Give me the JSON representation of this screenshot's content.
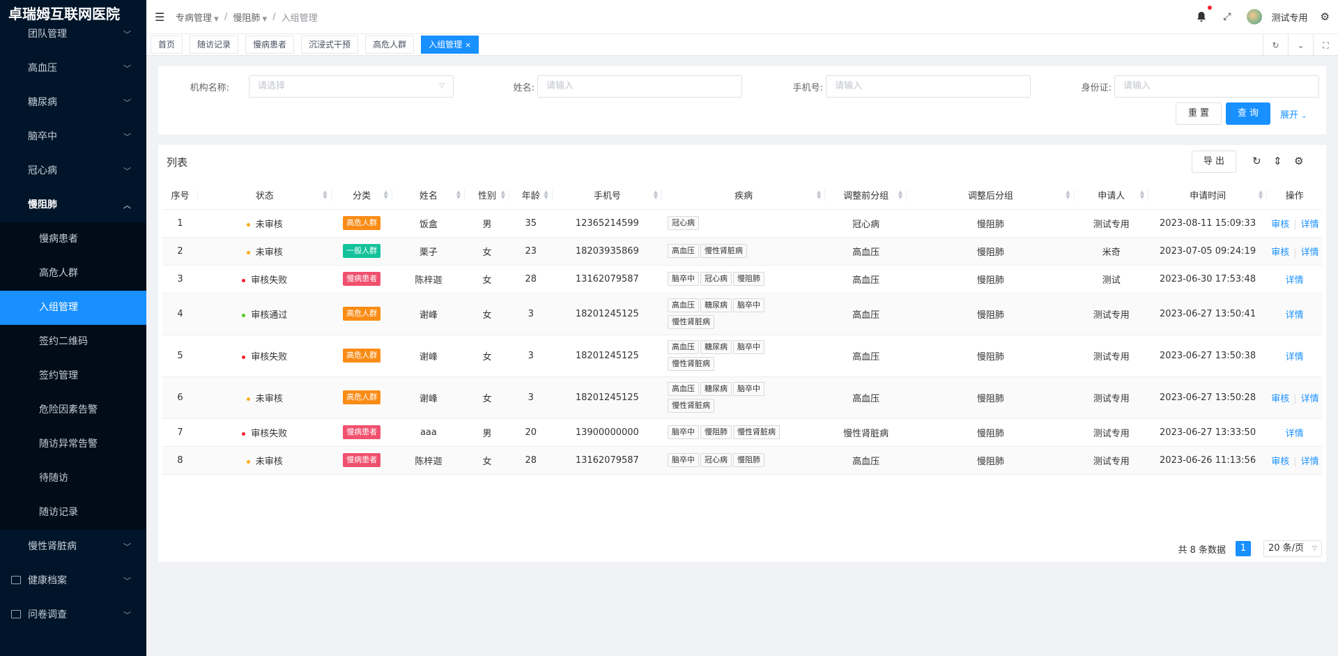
{
  "app": {
    "brand": "卓瑞姆互联网医院"
  },
  "sidebar": {
    "items": [
      {
        "label": "团队管理",
        "type": "group"
      },
      {
        "label": "高血压",
        "type": "group"
      },
      {
        "label": "糖尿病",
        "type": "group"
      },
      {
        "label": "脑卒中",
        "type": "group"
      },
      {
        "label": "冠心病",
        "type": "group"
      },
      {
        "label": "慢阻肺",
        "type": "group-open"
      },
      {
        "label": "慢病患者",
        "type": "sub"
      },
      {
        "label": "高危人群",
        "type": "sub"
      },
      {
        "label": "入组管理",
        "type": "sub-active"
      },
      {
        "label": "签约二维码",
        "type": "sub"
      },
      {
        "label": "签约管理",
        "type": "sub"
      },
      {
        "label": "危险因素告警",
        "type": "sub"
      },
      {
        "label": "随访异常告警",
        "type": "sub"
      },
      {
        "label": "待随访",
        "type": "sub"
      },
      {
        "label": "随访记录",
        "type": "sub"
      },
      {
        "label": "慢性肾脏病",
        "type": "group"
      },
      {
        "label": "健康档案",
        "type": "icon-group"
      },
      {
        "label": "问卷调查",
        "type": "icon-group"
      }
    ]
  },
  "header": {
    "breadcrumb": [
      "专病管理",
      "慢阻肺",
      "入组管理"
    ],
    "username": "测试专用"
  },
  "tabs": [
    "首页",
    "随访记录",
    "慢病患者",
    "沉浸式干预",
    "高危人群",
    "入组管理"
  ],
  "search": {
    "org_label": "机构名称:",
    "org_placeholder": "请选择",
    "name_label": "姓名:",
    "name_placeholder": "请输入",
    "phone_label": "手机号:",
    "phone_placeholder": "请输入",
    "id_label": "身份证:",
    "id_placeholder": "请输入",
    "reset_label": "重 置",
    "query_label": "查 询",
    "expand_label": "展开"
  },
  "table": {
    "title": "列表",
    "export_label": "导 出",
    "columns": [
      "序号",
      "状态",
      "分类",
      "姓名",
      "性别",
      "年龄",
      "手机号",
      "疾病",
      "调整前分组",
      "调整后分组",
      "申请人",
      "申请时间",
      "操作"
    ],
    "rows": [
      {
        "no": "1",
        "status": "未审核",
        "status_color": "#faad14",
        "category": "高危人群",
        "category_color": "#fa8c16",
        "name": "饭盒",
        "gender": "男",
        "age": "35",
        "phone": "12365214599",
        "diseases": [
          "冠心病"
        ],
        "before": "冠心病",
        "after": "慢阻肺",
        "applicant": "测试专用",
        "time": "2023-08-11 15:09:33",
        "actions": [
          "审核",
          "详情"
        ]
      },
      {
        "no": "2",
        "status": "未审核",
        "status_color": "#faad14",
        "category": "一般人群",
        "category_color": "#13c29b",
        "name": "栗子",
        "gender": "女",
        "age": "23",
        "phone": "18203935869",
        "diseases": [
          "高血压",
          "慢性肾脏病"
        ],
        "before": "高血压",
        "after": "慢阻肺",
        "applicant": "米奇",
        "time": "2023-07-05 09:24:19",
        "actions": [
          "审核",
          "详情"
        ]
      },
      {
        "no": "3",
        "status": "审核失败",
        "status_color": "#f5222d",
        "category": "慢病患者",
        "category_color": "#f0506e",
        "name": "陈梓迦",
        "gender": "女",
        "age": "28",
        "phone": "13162079587",
        "diseases": [
          "脑卒中",
          "冠心病",
          "慢阻肺"
        ],
        "before": "高血压",
        "after": "慢阻肺",
        "applicant": "测试",
        "time": "2023-06-30 17:53:48",
        "actions": [
          "详情"
        ]
      },
      {
        "no": "4",
        "status": "审核通过",
        "status_color": "#52c41a",
        "category": "高危人群",
        "category_color": "#fa8c16",
        "name": "谢峰",
        "gender": "女",
        "age": "3",
        "phone": "18201245125",
        "diseases": [
          "高血压",
          "糖尿病",
          "脑卒中",
          "慢性肾脏病"
        ],
        "before": "高血压",
        "after": "慢阻肺",
        "applicant": "测试专用",
        "time": "2023-06-27 13:50:41",
        "actions": [
          "详情"
        ]
      },
      {
        "no": "5",
        "status": "审核失败",
        "status_color": "#f5222d",
        "category": "高危人群",
        "category_color": "#fa8c16",
        "name": "谢峰",
        "gender": "女",
        "age": "3",
        "phone": "18201245125",
        "diseases": [
          "高血压",
          "糖尿病",
          "脑卒中",
          "慢性肾脏病"
        ],
        "before": "高血压",
        "after": "慢阻肺",
        "applicant": "测试专用",
        "time": "2023-06-27 13:50:38",
        "actions": [
          "详情"
        ]
      },
      {
        "no": "6",
        "status": "未审核",
        "status_color": "#faad14",
        "category": "高危人群",
        "category_color": "#fa8c16",
        "name": "谢峰",
        "gender": "女",
        "age": "3",
        "phone": "18201245125",
        "diseases": [
          "高血压",
          "糖尿病",
          "脑卒中",
          "慢性肾脏病"
        ],
        "before": "高血压",
        "after": "慢阻肺",
        "applicant": "测试专用",
        "time": "2023-06-27 13:50:28",
        "actions": [
          "审核",
          "详情"
        ]
      },
      {
        "no": "7",
        "status": "审核失败",
        "status_color": "#f5222d",
        "category": "慢病患者",
        "category_color": "#f0506e",
        "name": "aaa",
        "gender": "男",
        "age": "20",
        "phone": "13900000000",
        "diseases": [
          "脑卒中",
          "慢阻肺",
          "慢性肾脏病"
        ],
        "before": "慢性肾脏病",
        "after": "慢阻肺",
        "applicant": "测试专用",
        "time": "2023-06-27 13:33:50",
        "actions": [
          "详情"
        ]
      },
      {
        "no": "8",
        "status": "未审核",
        "status_color": "#faad14",
        "category": "慢病患者",
        "category_color": "#f0506e",
        "name": "陈梓迦",
        "gender": "女",
        "age": "28",
        "phone": "13162079587",
        "diseases": [
          "脑卒中",
          "冠心病",
          "慢阻肺"
        ],
        "before": "高血压",
        "after": "慢阻肺",
        "applicant": "测试专用",
        "time": "2023-06-26 11:13:56",
        "actions": [
          "审核",
          "详情"
        ]
      }
    ]
  },
  "pagination": {
    "total_text": "共 8 条数据",
    "current_page": "1",
    "page_size": "20 条/页"
  },
  "colors": {
    "primary": "#1890ff",
    "sidebar_bg": "#001529"
  }
}
